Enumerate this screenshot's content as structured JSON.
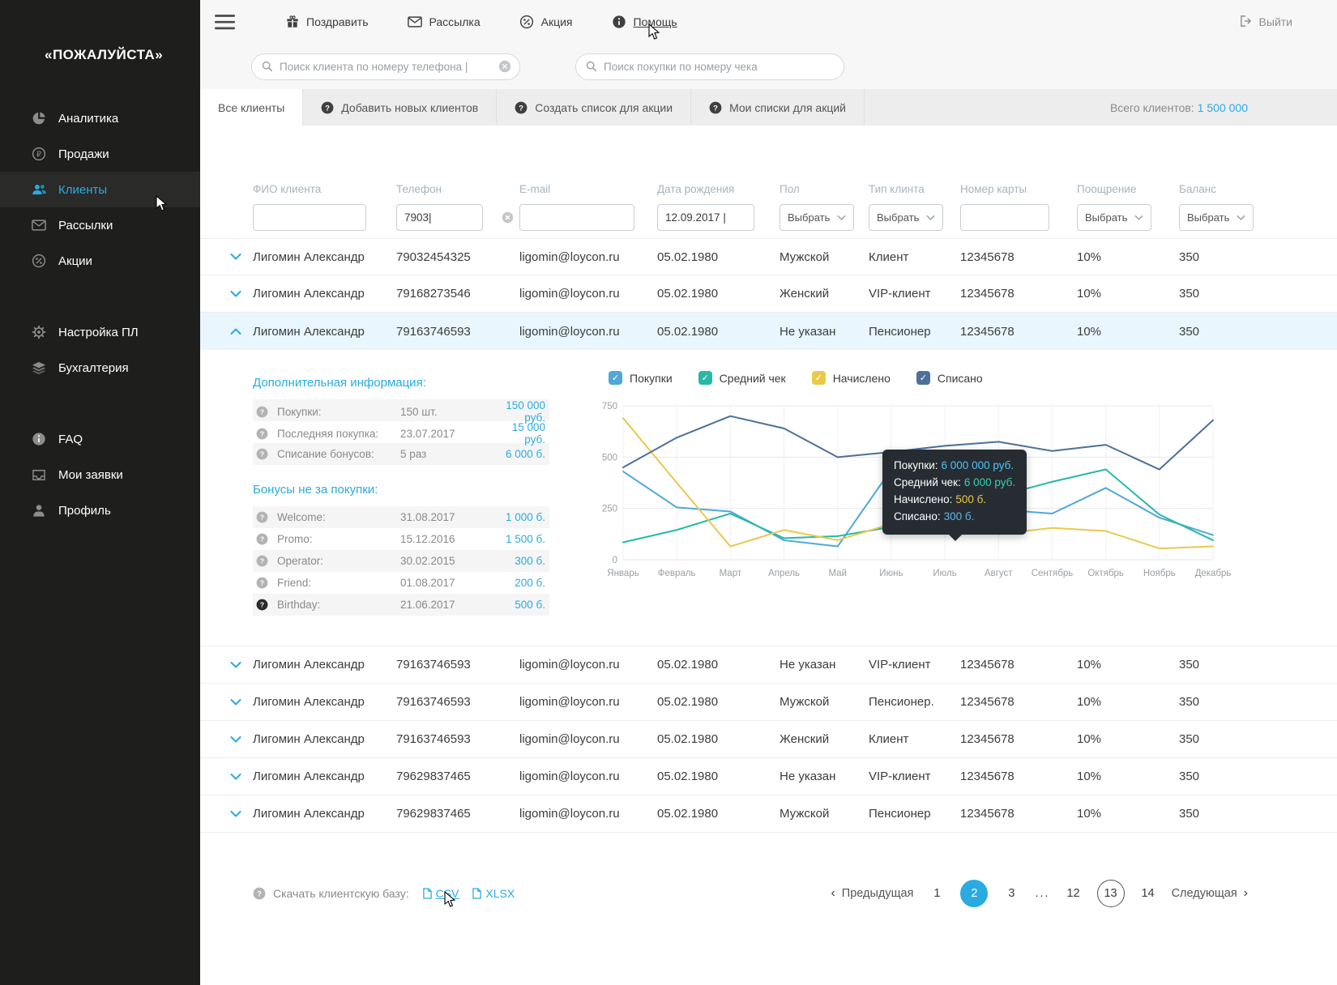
{
  "app": {
    "logo": "«ПОЖАЛУЙСТА»"
  },
  "colors": {
    "accent": "#29abe2"
  },
  "sidebar": {
    "items": [
      {
        "id": "analytics",
        "label": "Аналитика",
        "icon": "pie-chart-icon"
      },
      {
        "id": "sales",
        "label": "Продажи",
        "icon": "ruble-icon"
      },
      {
        "id": "clients",
        "label": "Клиенты",
        "icon": "users-icon",
        "active": true
      },
      {
        "id": "mailings",
        "label": "Рассылки",
        "icon": "envelope-icon"
      },
      {
        "id": "promos",
        "label": "Акции",
        "icon": "percent-icon"
      },
      {
        "id": "settings",
        "label": "Настройка ПЛ",
        "icon": "gear-icon",
        "gap": true
      },
      {
        "id": "accounting",
        "label": "Бухгалтерия",
        "icon": "layers-icon"
      },
      {
        "id": "faq",
        "label": "FAQ",
        "icon": "info-icon",
        "gap": true
      },
      {
        "id": "requests",
        "label": "Мои заявки",
        "icon": "inbox-icon"
      },
      {
        "id": "profile",
        "label": "Профиль",
        "icon": "user-icon"
      }
    ]
  },
  "topbar": {
    "actions": [
      {
        "id": "congratulate",
        "label": "Поздравить",
        "icon": "gift-icon"
      },
      {
        "id": "mailing",
        "label": "Рассылка",
        "icon": "envelope-icon"
      },
      {
        "id": "promo",
        "label": "Акция",
        "icon": "percent-icon"
      },
      {
        "id": "help",
        "label": "Помощь",
        "icon": "info-icon",
        "underlined": true
      }
    ],
    "logout_label": "Выйти"
  },
  "search": {
    "client_placeholder": "Поиск клиента по номеру телефона |",
    "purchase_placeholder": "Поиск покупки по номеру чека"
  },
  "tabs": {
    "active": "Все клиенты",
    "items": [
      {
        "id": "add-clients",
        "label": "Добавить новых клиентов"
      },
      {
        "id": "create-list",
        "label": "Создать список для акции"
      },
      {
        "id": "my-lists",
        "label": "Мои списки для акций"
      }
    ],
    "total_label": "Всего клиентов:",
    "total_value": "1 500 000"
  },
  "table": {
    "headers": [
      "ФИО клиента",
      "Телефон",
      "E-mail",
      "Дата рождения",
      "Пол",
      "Тип клинта",
      "Номер карты",
      "Поощрение",
      "Баланс"
    ],
    "filters": {
      "fio": "",
      "phone": "7903|",
      "email": "",
      "birthdate": "12.09.2017 |",
      "gender": "Выбрать",
      "client_type": "Выбрать",
      "card": "",
      "reward": "Выбрать",
      "balance": "Выбрать"
    },
    "rows": [
      {
        "name": "Лигомин Александр",
        "phone": "79032454325",
        "email": "ligomin@loycon.ru",
        "birthdate": "05.02.1980",
        "gender": "Мужской",
        "client_type": "Клиент",
        "card": "12345678",
        "reward": "10%",
        "balance": "350"
      },
      {
        "name": "Лигомин Александр",
        "phone": "79168273546",
        "email": "ligomin@loycon.ru",
        "birthdate": "05.02.1980",
        "gender": "Женский",
        "client_type": "VIP-клиент",
        "card": "12345678",
        "reward": "10%",
        "balance": "350"
      },
      {
        "name": "Лигомин Александр",
        "phone": "79163746593",
        "email": "ligomin@loycon.ru",
        "birthdate": "05.02.1980",
        "gender": "Не указан",
        "client_type": "Пенсионер",
        "card": "12345678",
        "reward": "10%",
        "balance": "350",
        "expanded": true
      },
      {
        "name": "Лигомин Александр",
        "phone": "79163746593",
        "email": "ligomin@loycon.ru",
        "birthdate": "05.02.1980",
        "gender": "Не указан",
        "client_type": "VIP-клиент",
        "card": "12345678",
        "reward": "10%",
        "balance": "350"
      },
      {
        "name": "Лигомин Александр",
        "phone": "79163746593",
        "email": "ligomin@loycon.ru",
        "birthdate": "05.02.1980",
        "gender": "Мужской",
        "client_type": "Пенсионер.",
        "card": "12345678",
        "reward": "10%",
        "balance": "350"
      },
      {
        "name": "Лигомин Александр",
        "phone": "79163746593",
        "email": "ligomin@loycon.ru",
        "birthdate": "05.02.1980",
        "gender": "Женский",
        "client_type": "Клиент",
        "card": "12345678",
        "reward": "10%",
        "balance": "350"
      },
      {
        "name": "Лигомин Александр",
        "phone": "79629837465",
        "email": "ligomin@loycon.ru",
        "birthdate": "05.02.1980",
        "gender": "Не указан",
        "client_type": "VIP-клиент",
        "card": "12345678",
        "reward": "10%",
        "balance": "350"
      },
      {
        "name": "Лигомин Александр",
        "phone": "79629837465",
        "email": "ligomin@loycon.ru",
        "birthdate": "05.02.1980",
        "gender": "Мужской",
        "client_type": "Пенсионер",
        "card": "12345678",
        "reward": "10%",
        "balance": "350"
      }
    ]
  },
  "details": {
    "additional": {
      "title": "Дополнительная информация:",
      "items": [
        {
          "label": "Покупки:",
          "value1": "150 шт.",
          "value2": "150 000 руб."
        },
        {
          "label": "Последняя покупка:",
          "value1": "23.07.2017",
          "value2": "15 000 руб."
        },
        {
          "label": "Списание бонусов:",
          "value1": "5 раз",
          "value2": "6 000 б."
        }
      ]
    },
    "bonuses": {
      "title": "Бонусы не за покупки:",
      "items": [
        {
          "label": "Welcome:",
          "value1": "31.08.2017",
          "value2": "1 000 б."
        },
        {
          "label": "Promo:",
          "value1": "15.12.2016",
          "value2": "1 500 б."
        },
        {
          "label": "Operator:",
          "value1": "30.02.2015",
          "value2": "300 б."
        },
        {
          "label": "Friend:",
          "value1": "01.08.2017",
          "value2": "200 б."
        },
        {
          "label": "Birthday:",
          "value1": "21.06.2017",
          "value2": "500 б.",
          "dark_icon": true
        }
      ]
    }
  },
  "chart_data": {
    "type": "line",
    "title": "",
    "xlabel": "",
    "ylabel": "",
    "categories": [
      "Январь",
      "Февраль",
      "Март",
      "Апрель",
      "Май",
      "Июнь",
      "Июль",
      "Август",
      "Сентябрь",
      "Октябрь",
      "Ноябрь",
      "Декабрь"
    ],
    "ylim": [
      0,
      750
    ],
    "yticks": [
      0,
      250,
      500,
      750
    ],
    "grid": true,
    "legend_position": "top",
    "series": [
      {
        "name": "Покупки",
        "color": "#4fa8d8",
        "values": [
          430,
          255,
          235,
          95,
          65,
          440,
          150,
          245,
          225,
          350,
          205,
          120
        ]
      },
      {
        "name": "Средний чек",
        "color": "#28b9a6",
        "values": [
          85,
          145,
          225,
          105,
          115,
          160,
          250,
          310,
          380,
          440,
          220,
          95
        ]
      },
      {
        "name": "Начислено",
        "color": "#e9c94c",
        "values": [
          690,
          375,
          65,
          145,
          95,
          175,
          345,
          125,
          155,
          140,
          55,
          65
        ]
      },
      {
        "name": "Списано",
        "color": "#4c7098",
        "values": [
          450,
          595,
          700,
          640,
          500,
          525,
          555,
          575,
          530,
          560,
          440,
          680
        ]
      }
    ],
    "tooltip": {
      "rows": [
        {
          "label": "Покупки:",
          "value": "6 000 000 руб.",
          "color": "#4fc3f7"
        },
        {
          "label": "Средний чек:",
          "value": "6 000 руб.",
          "color": "#35d0b5"
        },
        {
          "label": "Начислено:",
          "value": "500 б.",
          "color": "#e9c94c"
        },
        {
          "label": "Списано:",
          "value": "300 б.",
          "color": "#64b5e6"
        }
      ]
    }
  },
  "footer": {
    "download_label": "Скачать клиентскую базу:",
    "csv_label": "CSV",
    "xlsx_label": "XLSX"
  },
  "pagination": {
    "prev": "Предыдущая",
    "next": "Следующая",
    "pages": [
      {
        "label": "1"
      },
      {
        "label": "2",
        "active": true
      },
      {
        "label": "3"
      },
      {
        "label": "...",
        "dots": true
      },
      {
        "label": "12"
      },
      {
        "label": "13",
        "outlined": true
      },
      {
        "label": "14"
      }
    ]
  }
}
